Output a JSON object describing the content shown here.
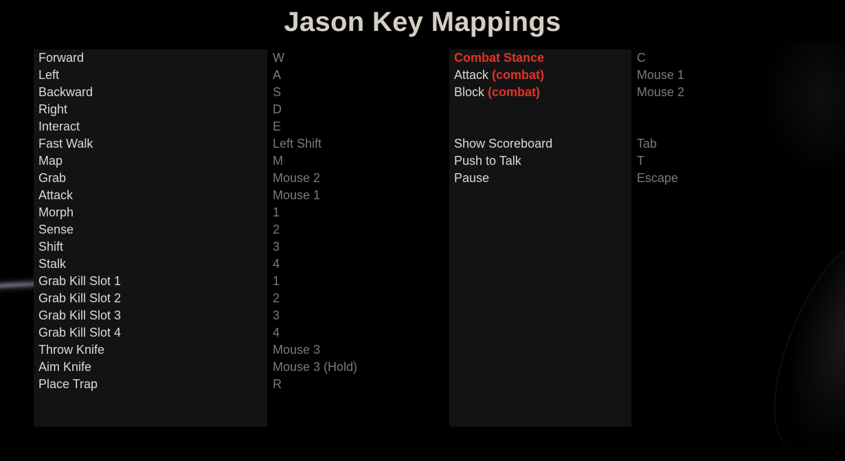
{
  "title": "Jason Key Mappings",
  "colors": {
    "title": "#d3cfc2",
    "action_text": "#dedbd3",
    "key_text": "#7d7b77",
    "highlight": "#e03428",
    "panel": "#161515",
    "background": "#000000"
  },
  "left_column": [
    {
      "action": "Forward",
      "key": "W"
    },
    {
      "action": "Left",
      "key": "A"
    },
    {
      "action": "Backward",
      "key": "S"
    },
    {
      "action": "Right",
      "key": "D"
    },
    {
      "action": "Interact",
      "key": "E"
    },
    {
      "action": "Fast Walk",
      "key": "Left Shift"
    },
    {
      "action": "Map",
      "key": "M"
    },
    {
      "action": "Grab",
      "key": "Mouse 2"
    },
    {
      "action": "Attack",
      "key": "Mouse 1"
    },
    {
      "action": "Morph",
      "key": "1"
    },
    {
      "action": "Sense",
      "key": "2"
    },
    {
      "action": "Shift",
      "key": "3"
    },
    {
      "action": "Stalk",
      "key": "4"
    },
    {
      "action": "Grab Kill Slot 1",
      "key": "1"
    },
    {
      "action": "Grab Kill Slot 2",
      "key": "2"
    },
    {
      "action": "Grab Kill Slot 3",
      "key": "3"
    },
    {
      "action": "Grab Kill Slot 4",
      "key": "4"
    },
    {
      "action": "Throw Knife",
      "key": "Mouse 3"
    },
    {
      "action": "Aim Knife",
      "key": "Mouse 3 (Hold)"
    },
    {
      "action": "Place Trap",
      "key": "R"
    }
  ],
  "right_column": [
    {
      "action": "",
      "highlight": "Combat Stance",
      "key": "C"
    },
    {
      "action": "Attack",
      "highlight": "(combat)",
      "key": "Mouse 1"
    },
    {
      "action": "Block",
      "highlight": "(combat)",
      "key": "Mouse 2"
    },
    {
      "action": "",
      "highlight": "",
      "key": ""
    },
    {
      "action": "",
      "highlight": "",
      "key": ""
    },
    {
      "action": "Show Scoreboard",
      "highlight": "",
      "key": "Tab"
    },
    {
      "action": "Push to Talk",
      "highlight": "",
      "key": "T"
    },
    {
      "action": "Pause",
      "highlight": "",
      "key": "Escape"
    }
  ]
}
